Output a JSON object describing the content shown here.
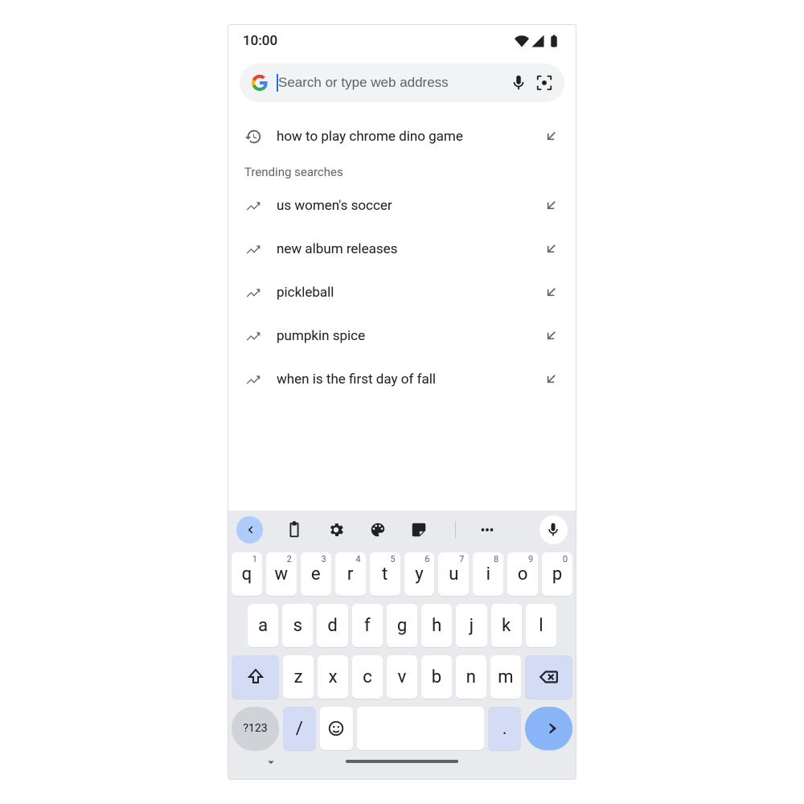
{
  "status": {
    "time": "10:00"
  },
  "search": {
    "placeholder": "Search or type web address"
  },
  "recent": {
    "label": "how to play chrome dino game"
  },
  "trending_header": "Trending searches",
  "trending": [
    {
      "label": "us women's soccer"
    },
    {
      "label": "new album releases"
    },
    {
      "label": "pickleball"
    },
    {
      "label": "pumpkin spice"
    },
    {
      "label": "when is the first day of fall"
    }
  ],
  "keyboard": {
    "row1": [
      {
        "k": "q",
        "n": "1"
      },
      {
        "k": "w",
        "n": "2"
      },
      {
        "k": "e",
        "n": "3"
      },
      {
        "k": "r",
        "n": "4"
      },
      {
        "k": "t",
        "n": "5"
      },
      {
        "k": "y",
        "n": "6"
      },
      {
        "k": "u",
        "n": "7"
      },
      {
        "k": "i",
        "n": "8"
      },
      {
        "k": "o",
        "n": "9"
      },
      {
        "k": "p",
        "n": "0"
      }
    ],
    "row2": [
      {
        "k": "a"
      },
      {
        "k": "s"
      },
      {
        "k": "d"
      },
      {
        "k": "f"
      },
      {
        "k": "g"
      },
      {
        "k": "h"
      },
      {
        "k": "j"
      },
      {
        "k": "k"
      },
      {
        "k": "l"
      }
    ],
    "row3": [
      {
        "k": "z"
      },
      {
        "k": "x"
      },
      {
        "k": "c"
      },
      {
        "k": "v"
      },
      {
        "k": "b"
      },
      {
        "k": "n"
      },
      {
        "k": "m"
      }
    ],
    "symbols_label": "?123",
    "slash": "/",
    "period": "."
  }
}
